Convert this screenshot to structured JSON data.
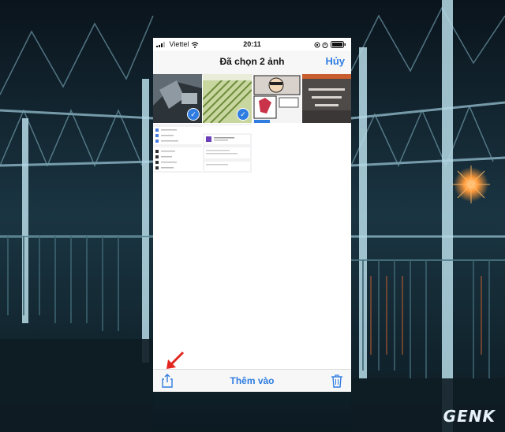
{
  "status_bar": {
    "carrier": "Viettel",
    "time": "20:11"
  },
  "nav": {
    "title": "Đã chọn 2 ảnh",
    "cancel_label": "Hủy"
  },
  "toolbar": {
    "add_label": "Thêm vào",
    "share_icon": "share-icon",
    "trash_icon": "trash-icon"
  },
  "watermark": {
    "text": "GENK"
  },
  "colors": {
    "accent": "#2f7de1",
    "annotation_arrow": "#e3261f"
  }
}
